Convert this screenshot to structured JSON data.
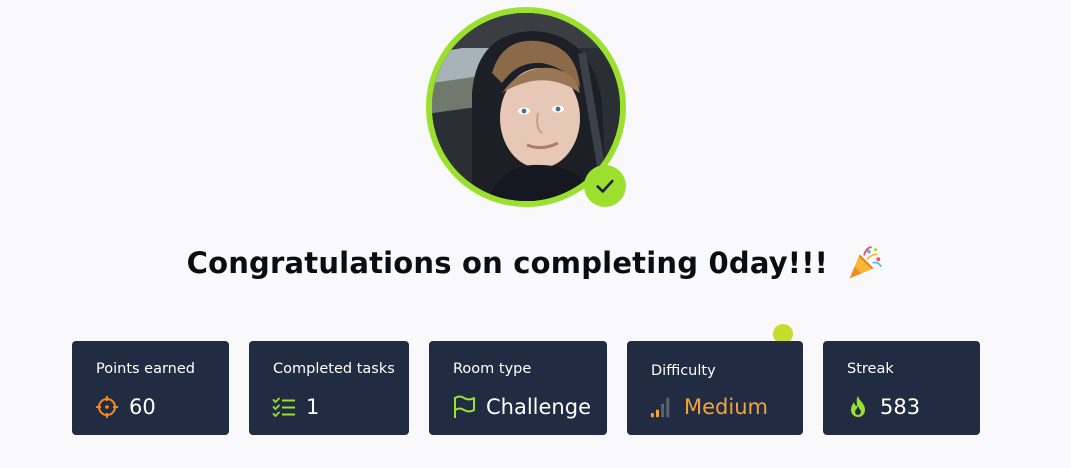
{
  "title": {
    "text": "Congratulations on completing 0day!!!",
    "emoji_icon": "party-popper-icon"
  },
  "avatar": {
    "badge_icon": "checkmark-icon",
    "ring_color": "#9be02f"
  },
  "stats": [
    {
      "label": "Points earned",
      "value": "60",
      "icon": "crosshair-icon",
      "icon_color": "#f5891f"
    },
    {
      "label": "Completed tasks",
      "value": "1",
      "icon": "task-list-icon",
      "icon_color": "#9be02f"
    },
    {
      "label": "Room type",
      "value": "Challenge",
      "icon": "flag-icon",
      "icon_color": "#9be02f"
    },
    {
      "label": "Difficulty",
      "value": "Medium",
      "icon": "signal-bars-icon",
      "icon_color": "#f5a337"
    },
    {
      "label": "Streak",
      "value": "583",
      "icon": "flame-icon",
      "icon_color": "#9be02f"
    }
  ],
  "colors": {
    "background": "#f9f9fb",
    "card": "#212c42",
    "accent_green": "#9be02f",
    "medium_orange": "#f5a337",
    "notification_dot": "#c4dc2b"
  }
}
